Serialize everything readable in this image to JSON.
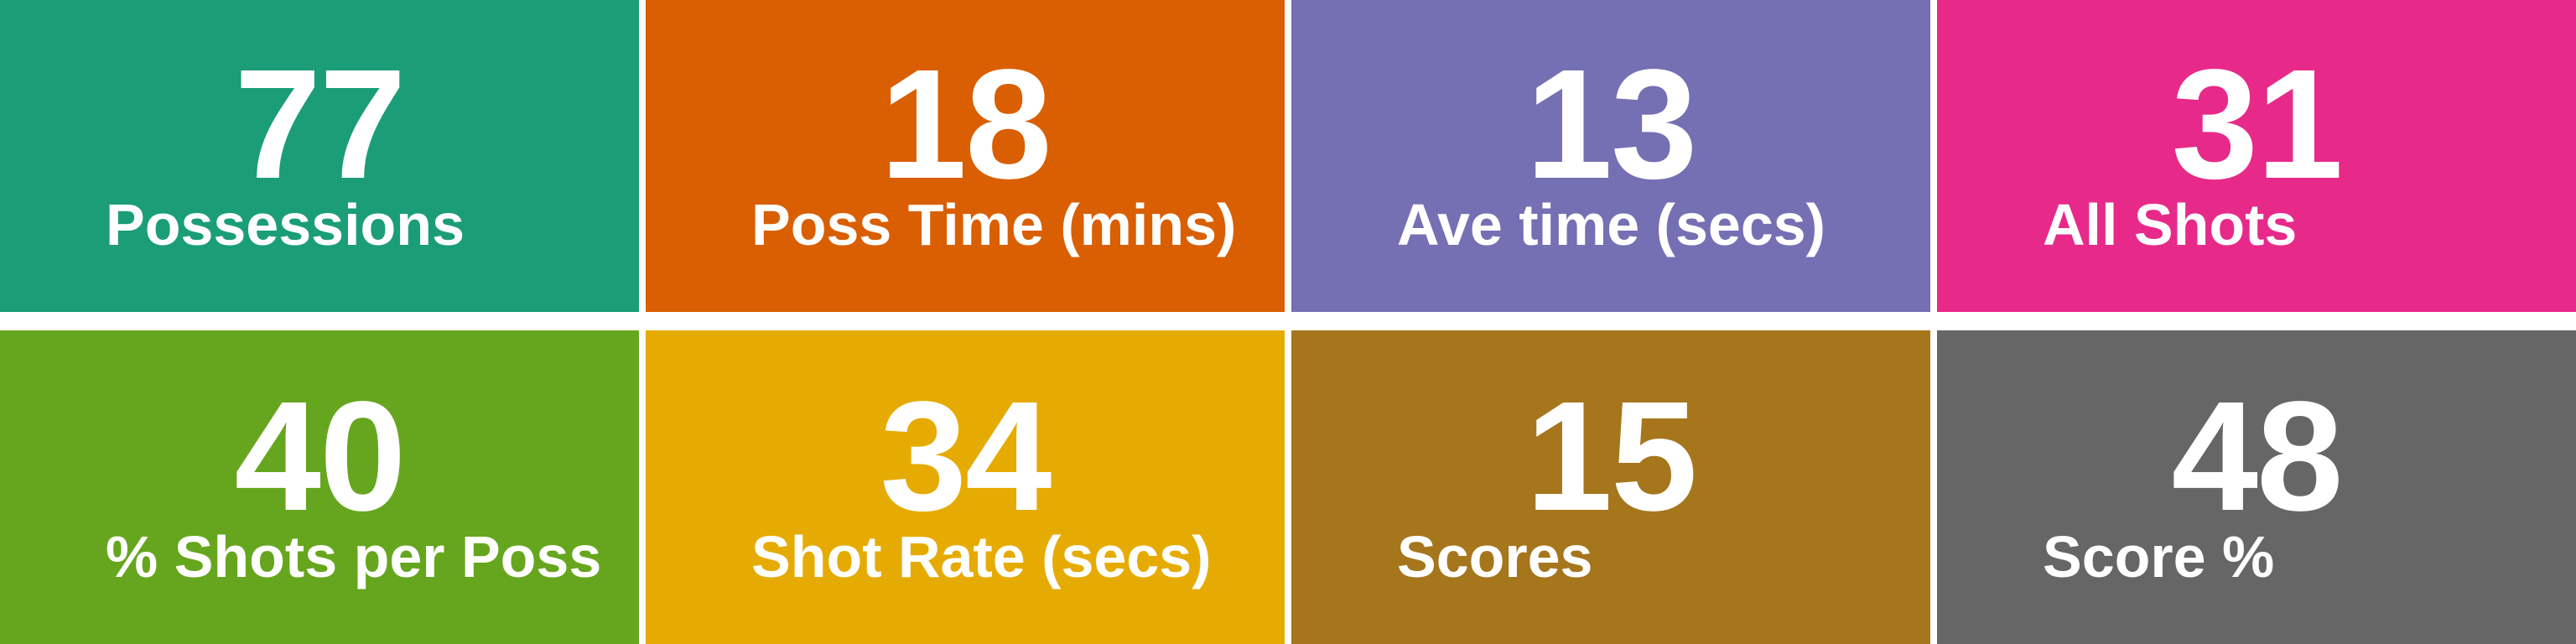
{
  "tiles": [
    {
      "value": "77",
      "label": "Possessions",
      "color": "#1b9e77"
    },
    {
      "value": "18",
      "label": "Poss Time (mins)",
      "color": "#d95f02"
    },
    {
      "value": "13",
      "label": "Ave time (secs)",
      "color": "#7570b3"
    },
    {
      "value": "31",
      "label": "All Shots",
      "color": "#e7298a"
    },
    {
      "value": "40",
      "label": "% Shots per Poss",
      "color": "#66a61e"
    },
    {
      "value": "34",
      "label": "Shot Rate (secs)",
      "color": "#e6ab02"
    },
    {
      "value": "15",
      "label": "Scores",
      "color": "#a6761d"
    },
    {
      "value": "48",
      "label": "Score %",
      "color": "#666666"
    }
  ]
}
